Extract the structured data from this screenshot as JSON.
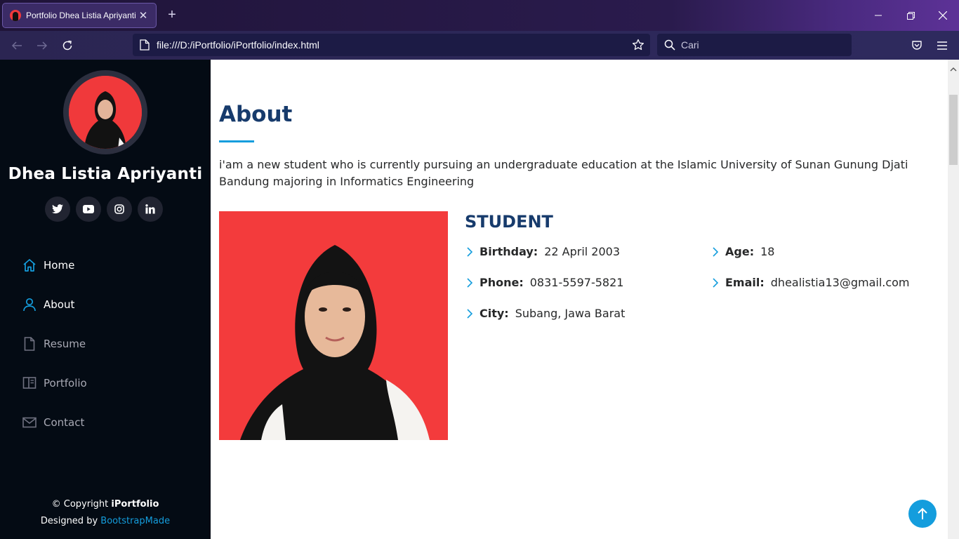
{
  "browser": {
    "tab_title": "Portfolio Dhea Listia Apriyanti",
    "url": "file:///D:/iPortfolio/iPortfolio/index.html",
    "search_placeholder": "Cari",
    "accent": "#149ddd"
  },
  "sidebar": {
    "name": "Dhea Listia Apriyanti",
    "social": [
      {
        "icon": "twitter-icon",
        "glyph": "t"
      },
      {
        "icon": "youtube-icon",
        "glyph": "▶"
      },
      {
        "icon": "instagram-icon",
        "glyph": "◎"
      },
      {
        "icon": "linkedin-icon",
        "glyph": "in"
      }
    ],
    "menu": [
      {
        "label": "Home",
        "icon": "home-icon",
        "active": true
      },
      {
        "label": "About",
        "icon": "person-icon",
        "active": true
      },
      {
        "label": "Resume",
        "icon": "file-icon",
        "active": false
      },
      {
        "label": "Portfolio",
        "icon": "book-icon",
        "active": false
      },
      {
        "label": "Contact",
        "icon": "envelope-icon",
        "active": false
      }
    ],
    "footer": {
      "copyright_prefix": "© Copyright",
      "brand": "iPortfolio",
      "designed_by": "Designed by",
      "designer": "BootstrapMade"
    }
  },
  "about": {
    "title": "About",
    "intro": "i'am a new student who is currently pursuing an undergraduate education at the Islamic University of Sunan Gunung Djati Bandung majoring in Informatics Engineering",
    "role": "STUDENT",
    "info": {
      "birthday": {
        "label": "Birthday:",
        "value": "22 April 2003"
      },
      "age": {
        "label": "Age:",
        "value": "18"
      },
      "phone": {
        "label": "Phone:",
        "value": "0831-5597-5821"
      },
      "email": {
        "label": "Email:",
        "value": "dhealistia13@gmail.com"
      },
      "city": {
        "label": "City:",
        "value": "Subang, Jawa Barat"
      }
    }
  }
}
